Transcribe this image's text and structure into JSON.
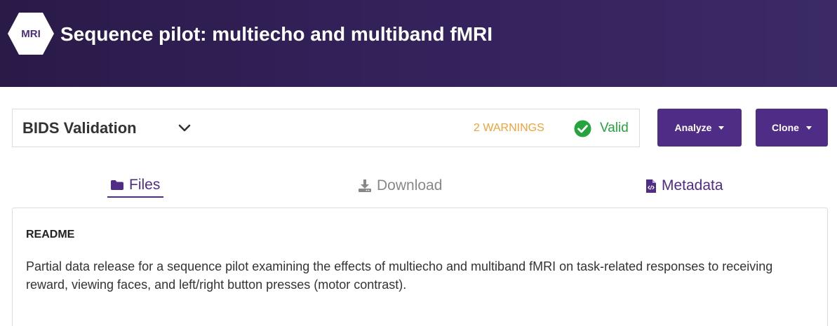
{
  "header": {
    "badge": "MRI",
    "title": "Sequence pilot: multiecho and multiband fMRI"
  },
  "validation": {
    "title": "BIDS Validation",
    "warnings": "2 WARNINGS",
    "status": "Valid",
    "status_icon": "check-circle-icon",
    "warning_color": "#f0a23a",
    "valid_color": "#25a33d"
  },
  "actions": {
    "analyze_label": "Analyze",
    "clone_label": "Clone",
    "accent_color": "#4f2d87"
  },
  "tabs": [
    {
      "label": "Files",
      "icon": "folder-icon",
      "active": true
    },
    {
      "label": "Download",
      "icon": "download-icon",
      "active": false,
      "disabled": true
    },
    {
      "label": "Metadata",
      "icon": "code-file-icon",
      "active": false
    }
  ],
  "readme": {
    "title": "README",
    "text": "Partial data release for a sequence pilot examining the effects of multiecho and multiband fMRI on task-related responses to receiving reward, viewing faces, and left/right button presses (motor contrast)."
  }
}
